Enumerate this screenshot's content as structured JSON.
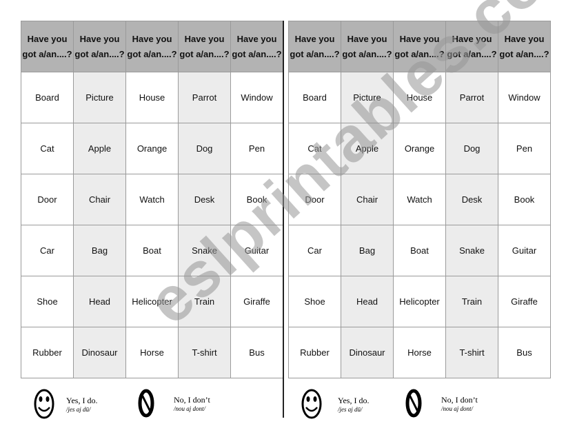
{
  "header": "Have you got a/an....?",
  "header_lines": [
    [
      "Have you",
      "got a/an....?"
    ],
    [
      "Have you",
      "got  a/an....?"
    ],
    [
      "Have you",
      "got a/an....?"
    ],
    [
      "Have you",
      "got a/an....?"
    ],
    [
      "Have you",
      "got a/an....?"
    ]
  ],
  "rows": [
    [
      "Board",
      "Picture",
      "House",
      "Parrot",
      "Window"
    ],
    [
      "Cat",
      "Apple",
      "Orange",
      "Dog",
      "Pen"
    ],
    [
      "Door",
      "Chair",
      "Watch",
      "Desk",
      "Book"
    ],
    [
      "Car",
      "Bag",
      "Boat",
      "Snake",
      "Guitar"
    ],
    [
      "Shoe",
      "Head",
      "Helicopter",
      "Train",
      "Giraffe"
    ],
    [
      "Rubber",
      "Dinosaur",
      "Horse",
      "T-shirt",
      "Bus"
    ]
  ],
  "legend": {
    "yes": {
      "icon": "smiley-icon",
      "text": "Yes, I do.",
      "phonetic": "/jes aj dū/"
    },
    "no": {
      "icon": "no-sign-icon",
      "text": "No, I don’t",
      "phonetic": "/nou aj dont/"
    }
  },
  "colors": {
    "header_bg": "#b3b3b3",
    "shaded_column": "#ececec"
  },
  "watermark": "eslprintables.com"
}
